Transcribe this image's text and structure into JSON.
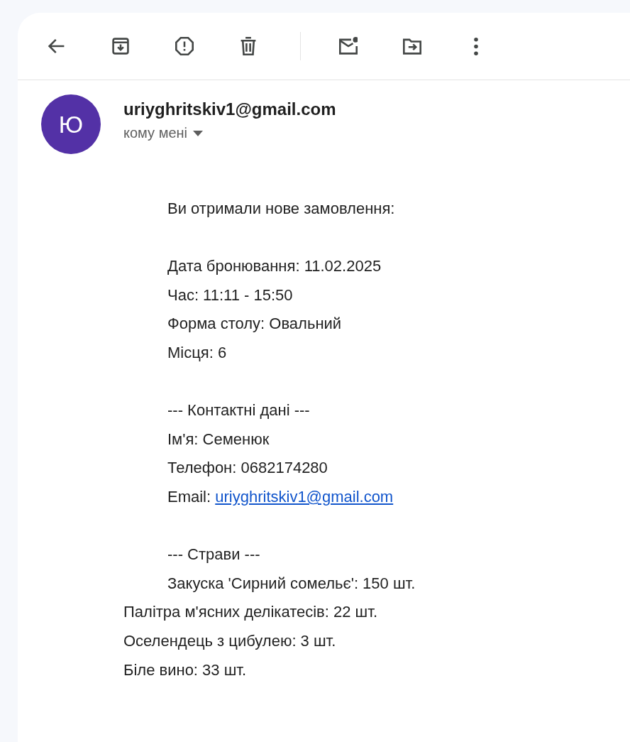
{
  "toolbar": {
    "left": [
      {
        "kind": "back"
      }
    ],
    "actions": [
      {
        "kind": "archive"
      },
      {
        "kind": "spam"
      },
      {
        "kind": "delete"
      }
    ],
    "more": [
      {
        "kind": "unread"
      },
      {
        "kind": "move"
      },
      {
        "kind": "more"
      }
    ]
  },
  "message": {
    "avatar_letter": "Ю",
    "sender": "uriyghritskiv1@gmail.com",
    "recipient": "кому мені",
    "body": {
      "indented_paragraphs": [
        [
          {
            "text": "Ви отримали нове замовлення:"
          }
        ],
        [
          {
            "text": "Дата бронювання: 11.02.2025"
          },
          {
            "text": "Час: 11:11 - 15:50"
          },
          {
            "text": "Форма столу: Овальний"
          },
          {
            "text": "Місця: 6"
          }
        ],
        [
          {
            "text": "--- Контактні дані ---"
          },
          {
            "text": "Ім'я: Семенюк"
          },
          {
            "text": "Телефон: 0682174280"
          },
          {
            "text": "Email: ",
            "link": "uriyghritskiv1@gmail.com"
          }
        ],
        [
          {
            "text": "--- Страви ---"
          },
          {
            "text": "Закуска 'Сирний сомельє': 150 шт."
          }
        ]
      ],
      "unindented_lines": [
        {
          "text": "Палітра м'ясних делікатесів: 22 шт."
        },
        {
          "text": "Оселендець з цибулею: 3 шт."
        },
        {
          "text": "Біле вино: 33 шт."
        }
      ]
    }
  }
}
